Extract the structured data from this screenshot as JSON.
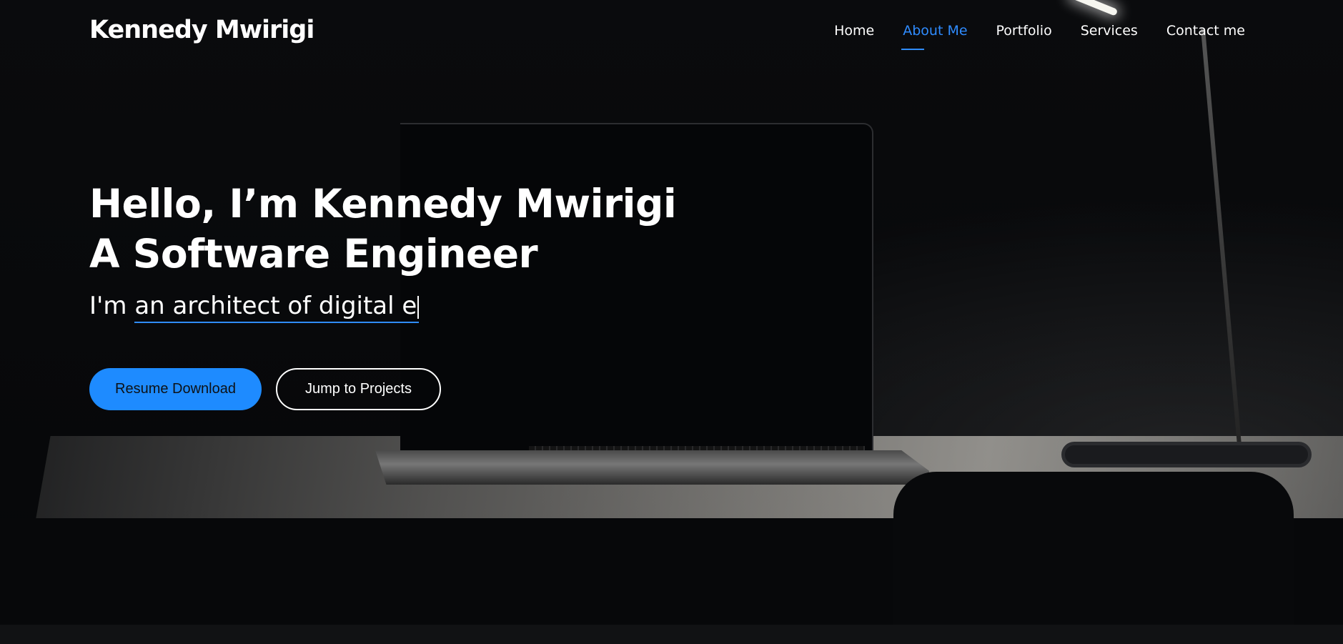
{
  "header": {
    "brand": "Kennedy Mwirigi",
    "nav": [
      {
        "label": "Home",
        "active": false
      },
      {
        "label": "About Me",
        "active": true
      },
      {
        "label": "Portfolio",
        "active": false
      },
      {
        "label": "Services",
        "active": false
      },
      {
        "label": "Contact me",
        "active": false
      }
    ]
  },
  "hero": {
    "title_line1": "Hello, I’m Kennedy Mwirigi",
    "title_line2": "A Software Engineer",
    "typed_prefix": "I'm",
    "typed_text": "an architect of digital e",
    "primary_button": "Resume Download",
    "secondary_button": "Jump to Projects"
  },
  "colors": {
    "accent": "#1e8bff",
    "background": "#0b0c0e"
  }
}
